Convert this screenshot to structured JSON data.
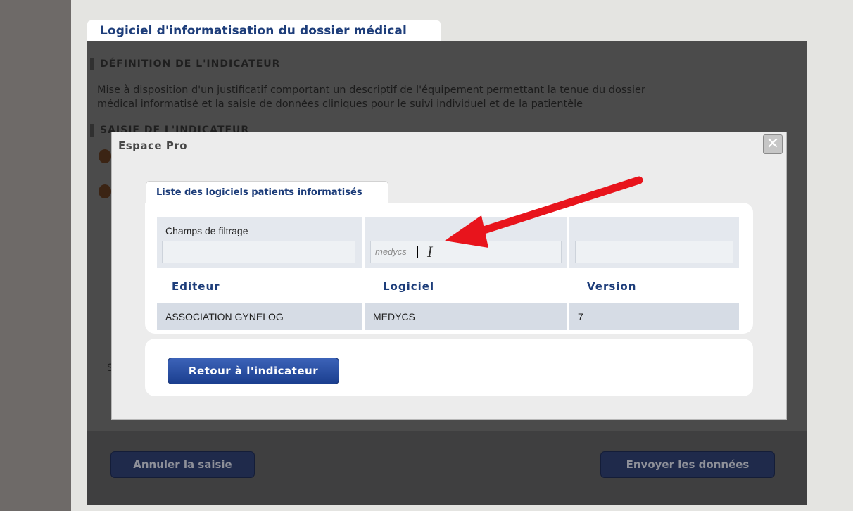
{
  "page": {
    "title": "Logiciel d'informatisation du dossier médical",
    "definition_heading": "DÉFINITION DE L'INDICATEUR",
    "definition_text_line1": "Mise à disposition d'un justificatif comportant un descriptif de l'équipement permettant la tenue du dossier",
    "definition_text_line2": "médical informatisé et la saisie de données cliniques pour le suivi individuel et de la patientèle",
    "entry_heading": "SAISIE DE L'INDICATEUR",
    "partial_letter": "S",
    "cancel_button": "Annuler la saisie",
    "send_button": "Envoyer les données"
  },
  "dialog": {
    "title": "Espace Pro",
    "close_glyph": "✕",
    "tab_label": "Liste des logiciels patients informatisés",
    "filter_label": "Champs de filtrage",
    "filters": {
      "editeur_value": "",
      "logiciel_value": "medycs",
      "version_value": ""
    },
    "columns": [
      "Editeur",
      "Logiciel",
      "Version"
    ],
    "rows": [
      {
        "editeur": "ASSOCIATION GYNELOG",
        "logiciel": "MEDYCS",
        "version": "7"
      }
    ],
    "back_button": "Retour à l'indicateur"
  },
  "colors": {
    "accent": "#1d3d7a",
    "arrow": "#e8141c",
    "button": "#1b3f8f"
  }
}
